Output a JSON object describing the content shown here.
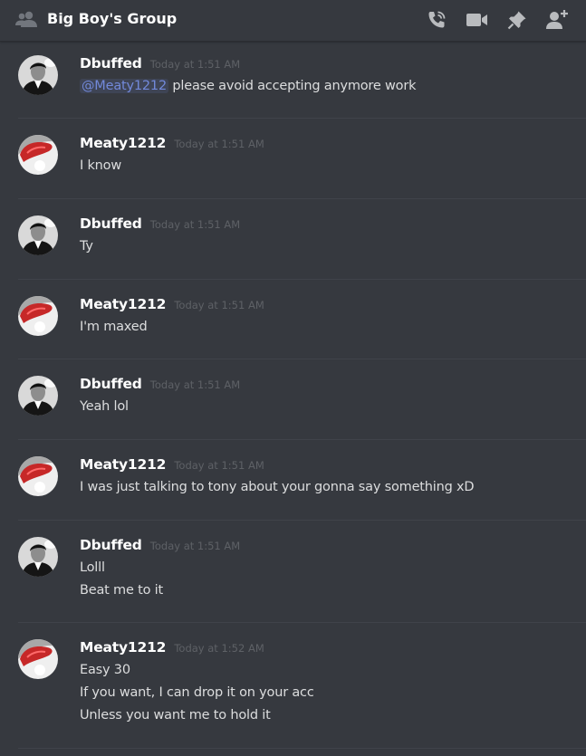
{
  "header": {
    "title": "Big Boy's Group",
    "icons": [
      "group-icon",
      "call-icon",
      "video-icon",
      "pin-icon",
      "add-member-icon"
    ]
  },
  "colors": {
    "background": "#36393f",
    "username": "#ffffff",
    "text": "#dcddde",
    "timestamp": "#5e6166",
    "mention": "#7289da"
  },
  "messages": [
    {
      "author": "Dbuffed",
      "time": "Today at 1:51 AM",
      "mention": "@Meaty1212",
      "lines": [
        " please avoid accepting anymore work"
      ]
    },
    {
      "author": "Meaty1212",
      "time": "Today at 1:51 AM",
      "lines": [
        "I know"
      ]
    },
    {
      "author": "Dbuffed",
      "time": "Today at 1:51 AM",
      "lines": [
        "Ty"
      ]
    },
    {
      "author": "Meaty1212",
      "time": "Today at 1:51 AM",
      "lines": [
        "I'm maxed"
      ]
    },
    {
      "author": "Dbuffed",
      "time": "Today at 1:51 AM",
      "lines": [
        "Yeah lol"
      ]
    },
    {
      "author": "Meaty1212",
      "time": "Today at 1:51 AM",
      "lines": [
        "I was just talking to tony about your gonna say something xD"
      ]
    },
    {
      "author": "Dbuffed",
      "time": "Today at 1:51 AM",
      "lines": [
        "Lolll",
        "Beat me to it"
      ]
    },
    {
      "author": "Meaty1212",
      "time": "Today at 1:52 AM",
      "lines": [
        "Easy 30",
        "If you want, I can drop it on your acc",
        "Unless you want me to hold it"
      ]
    }
  ]
}
